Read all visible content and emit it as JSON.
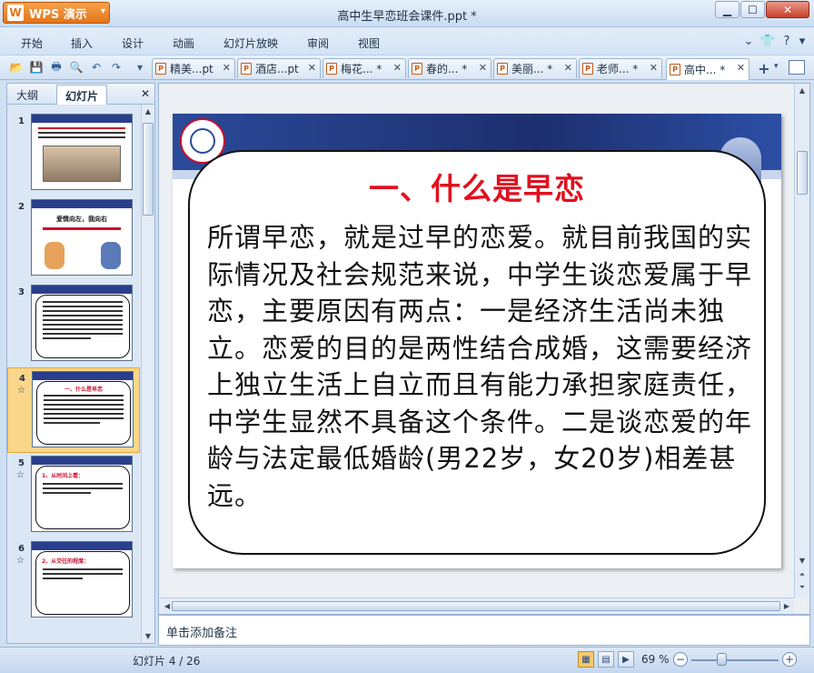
{
  "app": {
    "name": "WPS 演示",
    "document_title": "高中生早恋班会课件.ppt *"
  },
  "menu": [
    "开始",
    "插入",
    "设计",
    "动画",
    "幻灯片放映",
    "审阅",
    "视图"
  ],
  "doc_tabs": [
    {
      "label": "精美...pt"
    },
    {
      "label": "酒店...pt"
    },
    {
      "label": "梅花... *"
    },
    {
      "label": "春的... *"
    },
    {
      "label": "美丽... *"
    },
    {
      "label": "老师... *"
    },
    {
      "label": "高中... *"
    }
  ],
  "left_pane": {
    "tab_outline": "大纲",
    "tab_slides": "幻灯片"
  },
  "thumbnails": [
    {
      "number": "1",
      "title": ""
    },
    {
      "number": "2",
      "title": "爱情向左，我向右"
    },
    {
      "number": "3",
      "title": ""
    },
    {
      "number": "4",
      "title": "一、什么是早恋"
    },
    {
      "number": "5",
      "title": "1、从时间上看："
    },
    {
      "number": "6",
      "title": "2、从交往的程度："
    }
  ],
  "slide": {
    "title": "一、什么是早恋",
    "body": "所谓早恋，就是过早的恋爱。就目前我国的实际情况及社会规范来说，中学生谈恋爱属于早恋，主要原因有两点：一是经济生活尚未独立。恋爱的目的是两性结合成婚，这需要经济上独立生活上自立而且有能力承担家庭责任，中学生显然不具备这个条件。二是谈恋爱的年龄与法定最低婚龄(男22岁，女20岁)相差甚远。"
  },
  "notes_placeholder": "单击添加备注",
  "status": {
    "slide_count": "幻灯片 4 / 26",
    "zoom": "69 %",
    "zoom_level": 0.35
  },
  "colors": {
    "accent": "#e2741a",
    "title_red": "#e0101e",
    "header_blue": "#2b4a9a"
  }
}
